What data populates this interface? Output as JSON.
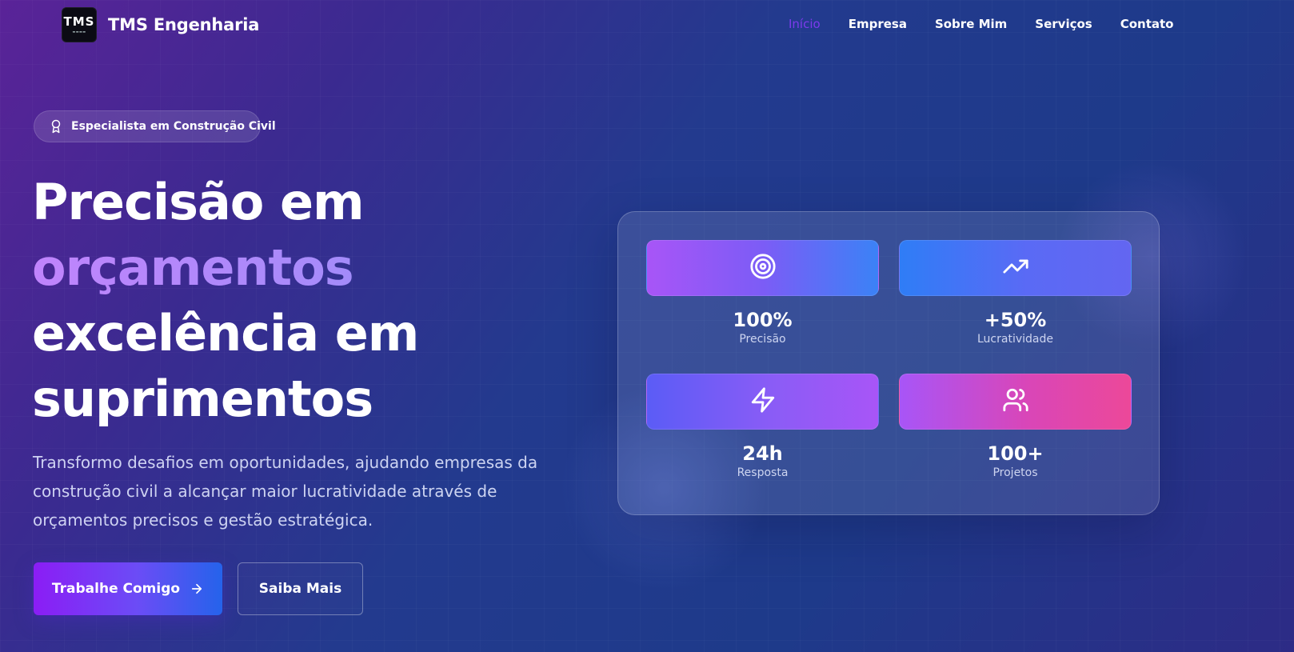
{
  "header": {
    "brand_name": "TMS Engenharia",
    "logo_text": "TMS",
    "nav": [
      {
        "label": "Início",
        "active": true
      },
      {
        "label": "Empresa",
        "active": false
      },
      {
        "label": "Sobre Mim",
        "active": false
      },
      {
        "label": "Serviços",
        "active": false
      },
      {
        "label": "Contato",
        "active": false
      }
    ]
  },
  "hero": {
    "badge": {
      "icon": "award-icon",
      "text": "Especialista em Construção Civil"
    },
    "headline": {
      "line1": "Precisão em",
      "line2": "orçamentos",
      "line3": "excelência em",
      "line4": "suprimentos"
    },
    "description": "Transformo desafios em oportunidades, ajudando empresas da construção civil a alcançar maior lucratividade através de orçamentos precisos e gestão estratégica.",
    "primary_button": {
      "label": "Trabalhe Comigo",
      "icon": "arrow-right-icon"
    },
    "secondary_button": {
      "label": "Saiba Mais"
    }
  },
  "stats": [
    {
      "icon": "target-icon",
      "value": "100%",
      "label": "Precisão"
    },
    {
      "icon": "trending-up-icon",
      "value": "+50%",
      "label": "Lucratividade"
    },
    {
      "icon": "zap-icon",
      "value": "24h",
      "label": "Resposta"
    },
    {
      "icon": "users-icon",
      "value": "100+",
      "label": "Projetos"
    }
  ],
  "colors": {
    "accent_purple": "#7c3aed",
    "gradient_start": "#8b1df5",
    "gradient_end": "#2563eb",
    "pink": "#ec4899"
  }
}
